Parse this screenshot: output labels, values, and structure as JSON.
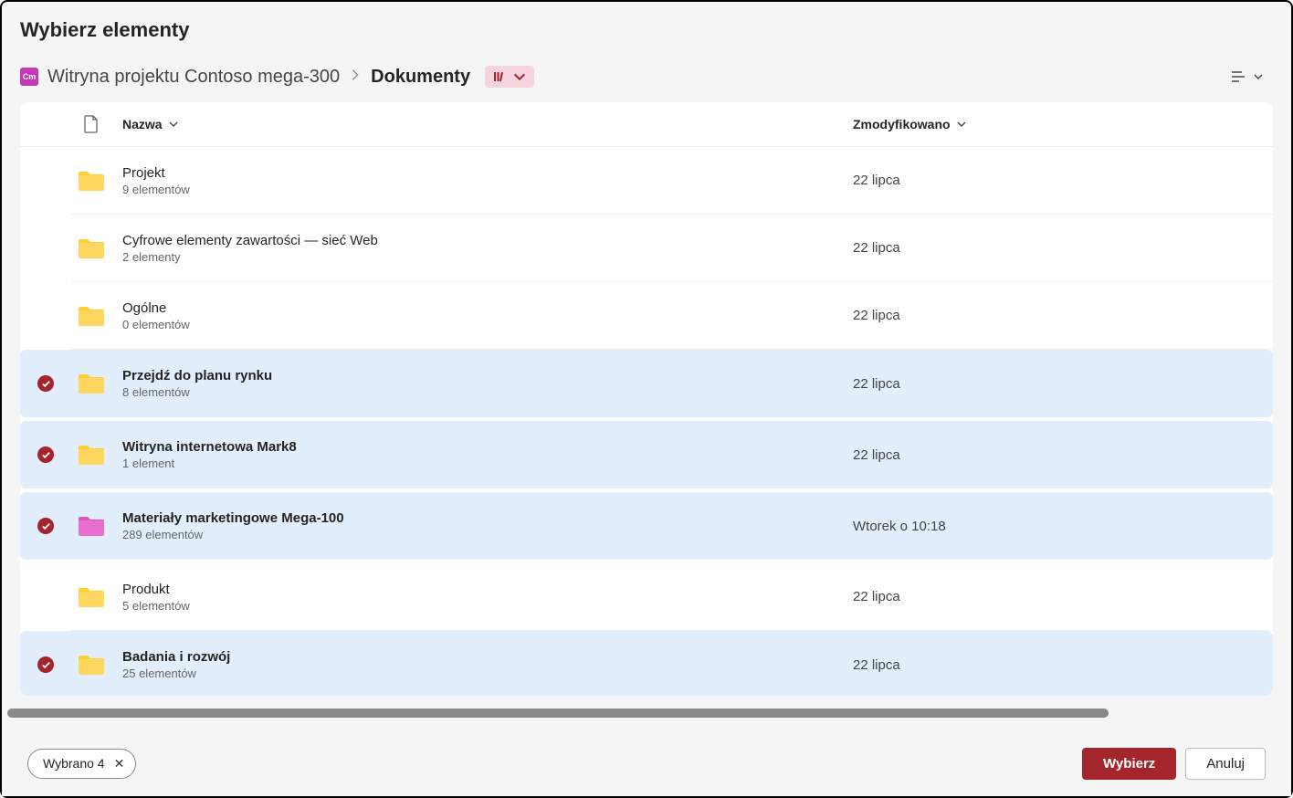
{
  "dialog": {
    "title": "Wybierz elementy"
  },
  "breadcrumb": {
    "site_icon_label": "Cm",
    "site_name": "Witryna projektu Contoso mega-300",
    "current": "Dokumenty"
  },
  "columns": {
    "name": "Nazwa",
    "modified": "Zmodyfikowano"
  },
  "items": [
    {
      "name": "Projekt",
      "meta": "9 elementów",
      "modified": "22 lipca",
      "selected": false,
      "color": "yellow"
    },
    {
      "name": "Cyfrowe elementy zawartości — sieć Web",
      "meta": "2 elementy",
      "modified": "22 lipca",
      "selected": false,
      "color": "yellow"
    },
    {
      "name": "Ogólne",
      "meta": "0 elementów",
      "modified": "22 lipca",
      "selected": false,
      "color": "yellow"
    },
    {
      "name": "Przejdź do planu rynku",
      "meta": "8 elementów",
      "modified": "22 lipca",
      "selected": true,
      "color": "yellow"
    },
    {
      "name": "Witryna internetowa Mark8",
      "meta": "1 element",
      "modified": "22 lipca",
      "selected": true,
      "color": "yellow"
    },
    {
      "name": "Materiały marketingowe Mega-100",
      "meta": "289 elementów",
      "modified": "Wtorek o 10:18",
      "selected": true,
      "color": "pink"
    },
    {
      "name": "Produkt",
      "meta": "5 elementów",
      "modified": "22 lipca",
      "selected": false,
      "color": "yellow"
    },
    {
      "name": "Badania i rozwój",
      "meta": "25 elementów",
      "modified": "22 lipca",
      "selected": true,
      "color": "yellow"
    }
  ],
  "footer": {
    "selected_label": "Wybrano 4",
    "select_button": "Wybierz",
    "cancel_button": "Anuluj"
  }
}
